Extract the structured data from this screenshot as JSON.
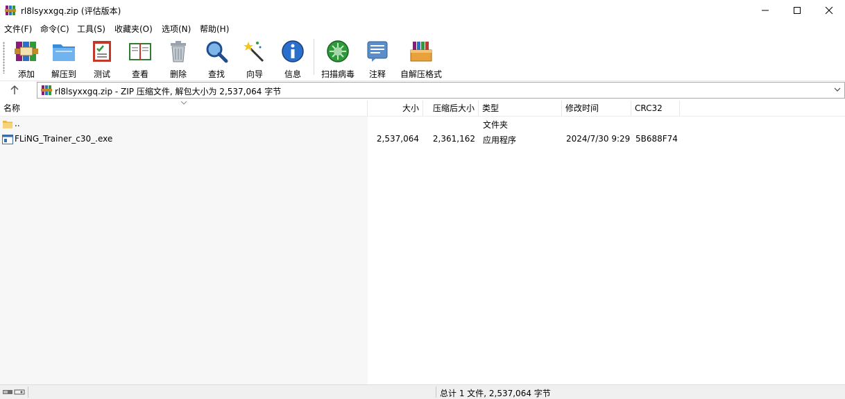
{
  "window": {
    "title": "rl8lsyxxgq.zip (评估版本)"
  },
  "menu": [
    "文件(F)",
    "命令(C)",
    "工具(S)",
    "收藏夹(O)",
    "选项(N)",
    "帮助(H)"
  ],
  "toolbar": {
    "add": "添加",
    "extract": "解压到",
    "test": "测试",
    "view": "查看",
    "delete": "删除",
    "find": "查找",
    "wizard": "向导",
    "info": "信息",
    "scan": "扫描病毒",
    "comment": "注释",
    "sfx": "自解压格式"
  },
  "address": {
    "path": "rl8lsyxxgq.zip - ZIP 压缩文件, 解包大小为 2,537,064 字节"
  },
  "columns": {
    "name": "名称",
    "size": "大小",
    "packed": "压缩后大小",
    "type": "类型",
    "modified": "修改时间",
    "crc": "CRC32"
  },
  "rows": [
    {
      "name": "..",
      "size": "",
      "packed": "",
      "type": "文件夹",
      "modified": "",
      "crc": ""
    },
    {
      "name": "FLiNG_Trainer_c30_.exe",
      "size": "2,537,064",
      "packed": "2,361,162",
      "type": "应用程序",
      "modified": "2024/7/30 9:29",
      "crc": "5B688F74"
    }
  ],
  "status": {
    "summary": "总计 1 文件, 2,537,064 字节"
  }
}
